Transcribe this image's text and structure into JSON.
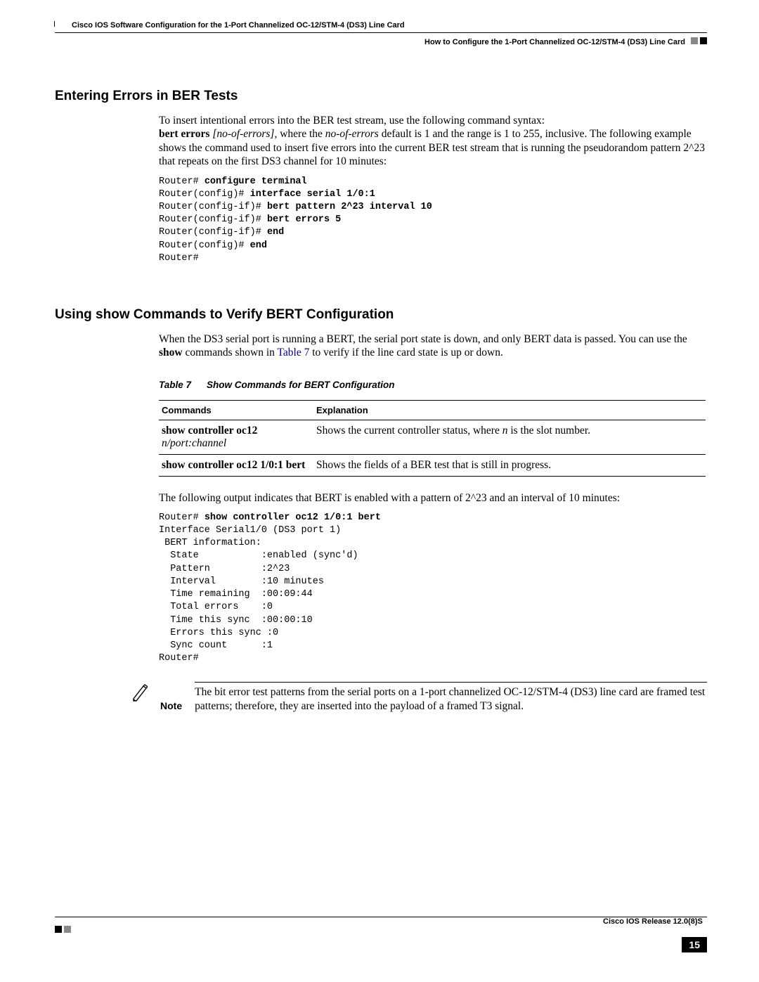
{
  "header": {
    "title": "Cisco IOS Software Configuration for the 1-Port Channelized OC-12/STM-4 (DS3) Line Card",
    "subtitle": "How to Configure the 1-Port Channelized OC-12/STM-4 (DS3) Line Card"
  },
  "section1": {
    "heading": "Entering Errors in BER Tests",
    "para1_a": "To insert intentional errors into the BER test stream, use the following command syntax:",
    "para1_b_bold": "bert errors",
    "para1_b_ital": " [no-of-errors]",
    "para1_b_rest": ", where the ",
    "para1_b_ital2": "no-of-errors",
    "para1_b_rest2": " default is 1 and the range is 1 to 255, inclusive. The following example shows the command used to insert five errors into the current BER test stream that is running the pseudorandom pattern 2^23 that repeats on the first DS3 channel for 10 minutes:",
    "code": {
      "l1a": "Router# ",
      "l1b": "configure terminal",
      "l2a": "Router(config)# ",
      "l2b": "interface serial 1/0:1",
      "l3a": "Router(config-if)# ",
      "l3b": "bert pattern 2^23 interval 10",
      "l4a": "Router(config-if)# ",
      "l4b": "bert errors 5",
      "l5a": "Router(config-if)# ",
      "l5b": "end",
      "l6a": "Router(config)# ",
      "l6b": "end",
      "l7": "Router#"
    }
  },
  "section2": {
    "heading": "Using show Commands to Verify BERT Configuration",
    "para1": "When the DS3 serial port is running a BERT, the serial port state is down, and only BERT data is passed. You can use the ",
    "para1_bold": "show",
    "para1_b": " commands shown in ",
    "para1_link": "Table 7",
    "para1_c": " to verify if the line card state is up or down.",
    "table": {
      "caption_no": "Table 7",
      "caption_txt": "Show Commands for BERT Configuration",
      "th1": "Commands",
      "th2": "Explanation",
      "r1c1_b": "show controller oc12 ",
      "r1c1_i": "n/port:channel",
      "r1c2_a": "Shows the current controller status, where ",
      "r1c2_i": "n",
      "r1c2_b": " is the slot number.",
      "r2c1": "show controller oc12 1/0:1 bert",
      "r2c2": "Shows the fields of a BER test that is still in progress."
    },
    "para2": "The following output indicates that BERT is enabled with a pattern of 2^23 and an interval of 10 minutes:",
    "code2": {
      "l1a": "Router# ",
      "l1b": "show controller oc12 1/0:1 bert",
      "rest": "\nInterface Serial1/0 (DS3 port 1)\n BERT information:\n  State           :enabled (sync'd)\n  Pattern         :2^23\n  Interval        :10 minutes\n  Time remaining  :00:09:44\n  Total errors    :0\n  Time this sync  :00:00:10\n  Errors this sync :0\n  Sync count      :1\nRouter#"
    }
  },
  "note": {
    "label": "Note",
    "text": "The bit error test patterns from the serial ports on a 1-port channelized OC-12/STM-4 (DS3) line card are framed test patterns; therefore, they are inserted into the payload of a framed T3 signal."
  },
  "footer": {
    "release": "Cisco IOS Release 12.0(8)S",
    "page": "15"
  }
}
